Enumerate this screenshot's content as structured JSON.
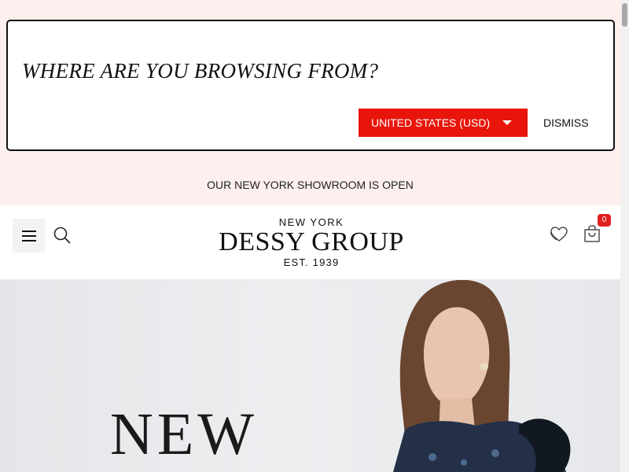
{
  "popup": {
    "title": "WHERE ARE YOU BROWSING FROM?",
    "country_select": "UNITED STATES (USD)",
    "dismiss_label": "DISMISS"
  },
  "announcement": "OUR NEW YORK SHOWROOM IS OPEN",
  "header": {
    "logo_top": "NEW YORK",
    "logo_main": "DESSY GROUP",
    "logo_bottom": "EST. 1939",
    "cart_count": "0"
  },
  "hero": {
    "title": "NEW"
  },
  "icons": {
    "menu": "hamburger-icon",
    "search": "search-icon",
    "wishlist": "heart-icon",
    "cart": "shopping-bag-icon",
    "caret": "caret-down-icon"
  },
  "colors": {
    "accent": "#e8150b",
    "banner_bg": "#fdefed",
    "badge": "#e02020"
  }
}
